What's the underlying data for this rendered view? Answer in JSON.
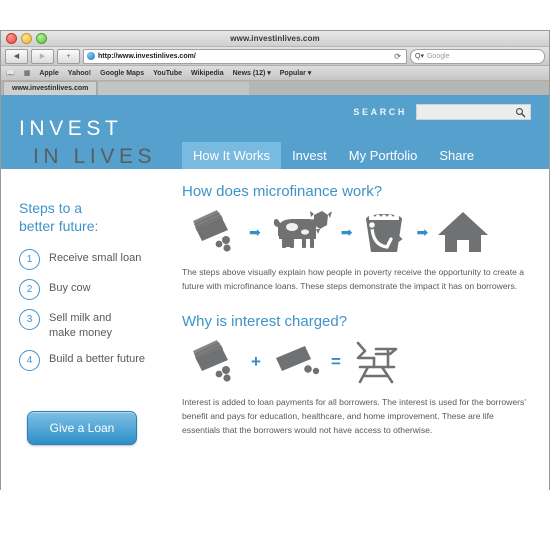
{
  "browser": {
    "window_title": "www.investinlives.com",
    "back_icon": "◀",
    "forward_icon": "▶",
    "add_icon": "+",
    "url": "http://www.investinlives.com/",
    "reload_icon": "⟳",
    "search_placeholder": "Google",
    "search_icon": "Q▾",
    "bookmarks_icon_1": "📖",
    "bookmarks_icon_2": "▦",
    "bookmarks": [
      "Apple",
      "Yahoo!",
      "Google Maps",
      "YouTube",
      "Wikipedia",
      "News (12) ▾",
      "Popular ▾"
    ],
    "tab_label": "www.investinlives.com"
  },
  "site": {
    "logo_line1": "INVEST",
    "logo_line2": "IN LIVES",
    "search_label": "SEARCH",
    "search_value": "",
    "search_icon": "search-icon",
    "nav": [
      {
        "label": "How It Works",
        "active": true
      },
      {
        "label": "Invest",
        "active": false
      },
      {
        "label": "My Portfolio",
        "active": false
      },
      {
        "label": "Share",
        "active": false
      }
    ],
    "colors": {
      "header_blue": "#55a0cd",
      "active_tab_blue": "#79bae0",
      "heading_blue": "#3f93c8",
      "arrow_blue": "#2f8ecb",
      "body_gray": "#58595b",
      "icon_gray": "#6f7173"
    }
  },
  "sidebar": {
    "title": "Steps to a better future:",
    "title_line1": "Steps to a",
    "title_line2": "better future:",
    "steps": [
      {
        "number": "1",
        "text": "Receive small loan"
      },
      {
        "number": "2",
        "text": "Buy cow"
      },
      {
        "number": "3",
        "text": "Sell milk and make money"
      },
      {
        "number": "4",
        "text": "Build a better future"
      }
    ],
    "cta_label": "Give a Loan"
  },
  "main": {
    "section1": {
      "heading": "How does microfinance work?",
      "diagram_items": [
        "money-icon",
        "cow-icon",
        "bucket-icon",
        "house-icon"
      ],
      "arrow_symbol": "➡",
      "paragraph": "The steps above visually explain how people in poverty receive the opportunity to create a future with microfinance loans. These steps demonstrate the impact it has on borrowers."
    },
    "section2": {
      "heading": "Why is interest charged?",
      "diagram_items": [
        "money-icon",
        "money-bill-icon",
        "school-desk-icon"
      ],
      "plus_symbol": "+",
      "equals_symbol": "=",
      "paragraph": "Interest is added to loan payments for all borrowers. The interest is used for the borrowers' benefit and pays for education, healthcare, and home improvement. These are life essentials that the borrowers would not have access to otherwise."
    }
  }
}
